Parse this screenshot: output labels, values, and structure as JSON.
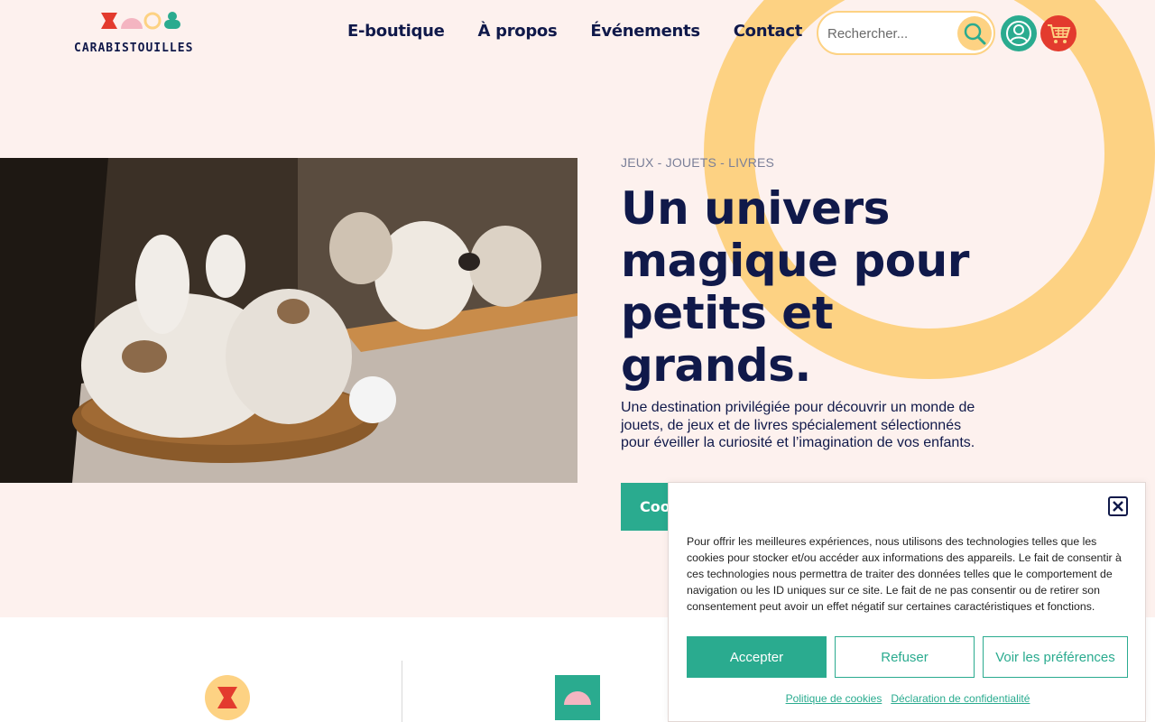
{
  "brand": {
    "name": "CARABISTOUILLES"
  },
  "nav": {
    "items": [
      {
        "label": "E-boutique"
      },
      {
        "label": "À propos"
      },
      {
        "label": "Événements"
      },
      {
        "label": "Contact"
      }
    ]
  },
  "search": {
    "placeholder": "Rechercher..."
  },
  "icons": {
    "search": "search-icon",
    "account": "user-icon",
    "cart": "cart-icon"
  },
  "hero": {
    "kicker": "JEUX - JOUETS - LIVRES",
    "headline": "Un univers magique pour petits et grands.",
    "lead": "Une destination privilégiée pour découvrir un monde de jouets, de jeux et de livres spécialement sélectionnés pour éveiller la curiosité et l’imagination de vos enfants.",
    "cta_label": "Coo"
  },
  "cookie_banner": {
    "text": "Pour offrir les meilleures expériences, nous utilisons des technologies telles que les cookies pour stocker et/ou accéder aux informations des appareils. Le fait de consentir à ces technologies nous permettra de traiter des données telles que le comportement de navigation ou les ID uniques sur ce site. Le fait de ne pas consentir ou de retirer son consentement peut avoir un effet négatif sur certaines caractéristiques et fonctions.",
    "accept_label": "Accepter",
    "refuse_label": "Refuser",
    "prefs_label": "Voir les préférences",
    "links": [
      {
        "label": "Politique de cookies"
      },
      {
        "label": "Déclaration de confidentialité"
      }
    ]
  },
  "colors": {
    "background": "#fdf1ee",
    "navy": "#10194a",
    "teal": "#2aab8f",
    "yellow": "#fdd283",
    "red": "#e33b2e",
    "pink": "#f4b5c1"
  }
}
